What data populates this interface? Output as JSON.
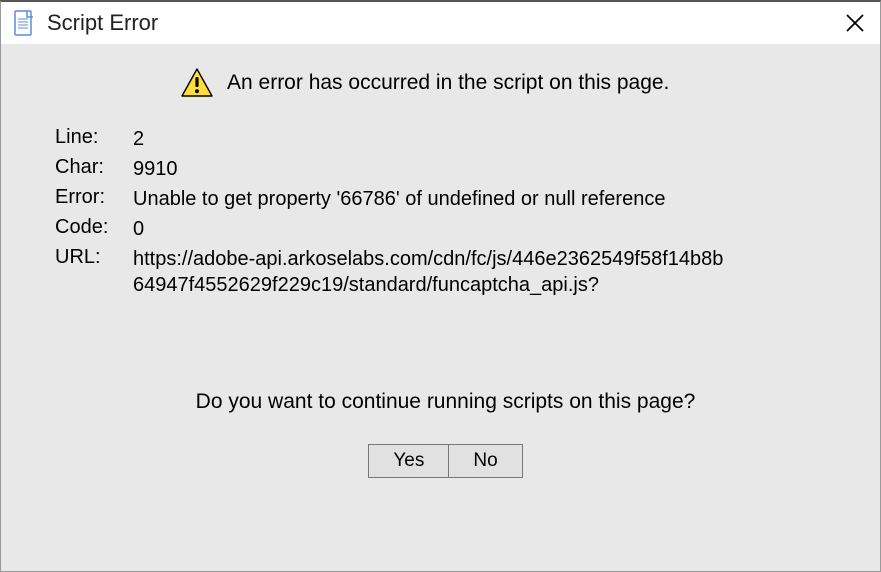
{
  "title": "Script Error",
  "main_message": "An error has occurred in the script on this page.",
  "labels": {
    "line": "Line:",
    "char": "Char:",
    "error": "Error:",
    "code": "Code:",
    "url": "URL:"
  },
  "values": {
    "line": "2",
    "char": "9910",
    "error": "Unable to get property '66786' of undefined or null reference",
    "code": "0",
    "url": "https://adobe-api.arkoselabs.com/cdn/fc/js/446e2362549f58f14b8b64947f4552629f229c19/standard/funcaptcha_api.js?"
  },
  "prompt": "Do you want to continue running scripts on this page?",
  "buttons": {
    "yes": "Yes",
    "no": "No"
  }
}
